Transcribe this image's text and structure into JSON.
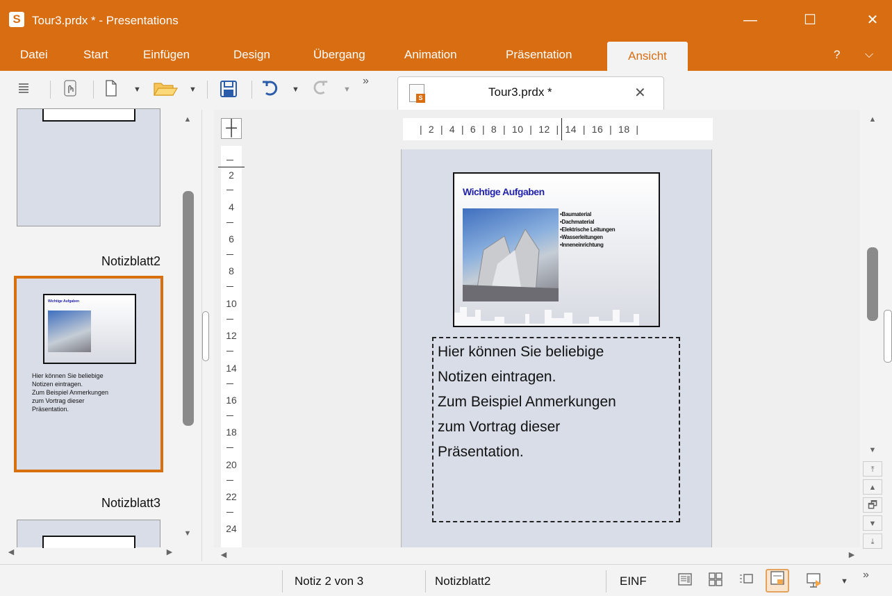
{
  "window": {
    "app_icon": "S",
    "title": "Tour3.prdx * - Presentations",
    "minimize": "—",
    "maximize": "☐",
    "close": "✕"
  },
  "menu": {
    "items": [
      "Datei",
      "Start",
      "Einfügen",
      "Design",
      "Übergang",
      "Animation",
      "Präsentation"
    ],
    "active": "Ansicht",
    "help": "?",
    "collapse": "⌵"
  },
  "toolbar": {
    "overflow": "»"
  },
  "document_tab": {
    "title": "Tour3.prdx *",
    "close": "✕"
  },
  "thumbnails": {
    "label_2": "Notizblatt2",
    "label_3": "Notizblatt3",
    "mini_title": "Wichtige Aufgaben",
    "mini_notes": [
      "Hier können Sie beliebige",
      "Notizen eintragen.",
      "Zum Beispiel Anmerkungen",
      "zum Vortrag dieser",
      "Präsentation."
    ]
  },
  "ruler": {
    "horizontal_labels": [
      "2",
      "4",
      "6",
      "8",
      "10",
      "12",
      "14",
      "16",
      "18"
    ],
    "vertical_labels": [
      "2",
      "4",
      "6",
      "8",
      "10",
      "12",
      "14",
      "16",
      "18",
      "20",
      "22",
      "24"
    ]
  },
  "slide": {
    "title": "Wichtige Aufgaben",
    "bullets": [
      "•Baumaterial",
      "•Dachmaterial",
      "•Elektrische Leitungen",
      "•Wasserleitungen",
      "•Inneneinrichtung"
    ]
  },
  "notes": {
    "lines": [
      "Hier können Sie beliebige",
      "Notizen eintragen.",
      "Zum Beispiel Anmerkungen",
      "zum Vortrag dieser",
      "Präsentation."
    ]
  },
  "status": {
    "note_position": "Notiz 2 von 3",
    "page_name": "Notizblatt2",
    "mode": "EINF",
    "overflow": "»"
  },
  "colors": {
    "accent": "#d86d12",
    "page_bg": "#d8dde8",
    "slide_title": "#2222aa"
  }
}
